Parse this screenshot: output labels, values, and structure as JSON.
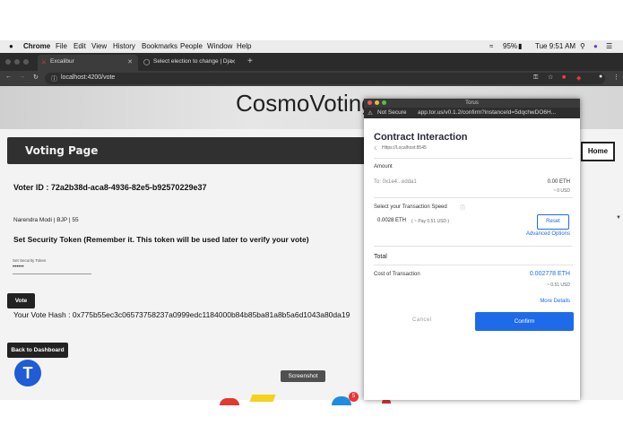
{
  "menubar": {
    "items": [
      "Chrome",
      "File",
      "Edit",
      "View",
      "History",
      "Bookmarks",
      "People",
      "Window",
      "Help"
    ],
    "battery": "95%",
    "clock": "Tue 9:51 AM"
  },
  "browser": {
    "tabs": [
      {
        "title": "Excalibur"
      },
      {
        "title": "Select election to change | Dja"
      }
    ],
    "url": "localhost:4200/vote"
  },
  "app": {
    "name": "CosmoVoting",
    "page_title": "Voting Page",
    "home_label": "Home",
    "voter_id_label": "Voter ID : 72a2b38d-aca8-4936-82e5-b92570229e37",
    "candidate": "Narendra Modi | BJP | 55",
    "token_heading": "Set Security Token (Remember it. This token will be used later to verify your vote)",
    "token_field_label": "Set Security Token",
    "token_value": "••••••",
    "vote_label": "Vote",
    "vote_hash": "Your Vote Hash : 0x775b55ec3c06573758237a0999edc1184000b84b85ba81a8b5a6d1043a80da19",
    "back_label": "Back to Dashboard",
    "screenshot_label": "Screenshot",
    "badge_count": "5"
  },
  "torus": {
    "window_title": "Torus",
    "security": "Not Secure",
    "url": "app.tor.us/v0.1.2/confirm?instanceId=5dqchwDO6H...",
    "title": "Contract Interaction",
    "network": "Https://Localhost:8545",
    "amount_label": "Amount",
    "to": "To: 0x1e4...edda1",
    "amount_eth": "0.00 ETH",
    "amount_usd": "~ 0 USD",
    "speed_label": "Select your Transaction Speed",
    "fee_eth": "0.0028 ETH",
    "fee_note": "( ~ Pay 0.51 USD )",
    "reset_label": "Reset",
    "advanced_label": "Advanced Options",
    "total_label": "Total",
    "cost_label": "Cost of Transaction",
    "cost_eth": "0.002778 ETH",
    "cost_usd": "~ 0.51 USD",
    "more_label": "More Details",
    "cancel_label": "Cancel",
    "confirm_label": "Confirm"
  },
  "colors": {
    "accent": "#1e6bea",
    "dark": "#222222"
  }
}
